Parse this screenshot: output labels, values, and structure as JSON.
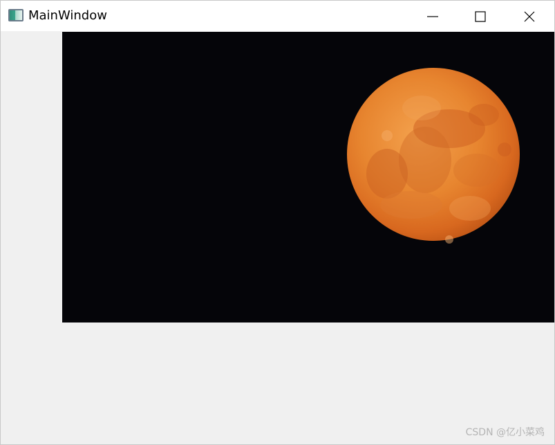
{
  "window": {
    "title": "MainWindow",
    "icon": "qt-window-icon",
    "controls": {
      "minimize": "minimize-icon",
      "maximize": "maximize-icon",
      "close": "close-icon"
    }
  },
  "content": {
    "image_subject": "full moon at night",
    "colors": {
      "sky": "#050509",
      "moon": "#e07a2c",
      "background": "#f0f0f0"
    }
  },
  "watermark": {
    "text": "CSDN @亿小菜鸡"
  }
}
